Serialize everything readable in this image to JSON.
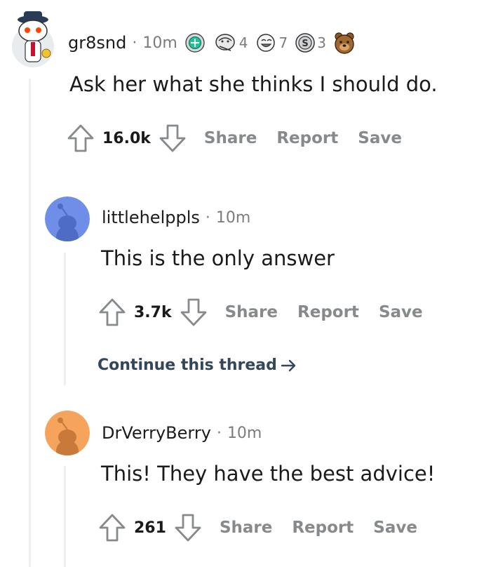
{
  "comments": [
    {
      "username": "gr8snd",
      "separator": "·",
      "time": "10m",
      "awards": [
        {
          "icon": "helpful-award-icon",
          "count": ""
        },
        {
          "icon": "wholesome-seal-award-icon",
          "count": "4"
        },
        {
          "icon": "laughing-face-award-icon",
          "count": "7"
        },
        {
          "icon": "silver-award-icon",
          "count": "3"
        },
        {
          "icon": "bear-award-icon",
          "count": ""
        }
      ],
      "body": "Ask her what she thinks I should do.",
      "score": "16.0k",
      "share_label": "Share",
      "report_label": "Report",
      "save_label": "Save"
    },
    {
      "username": "littlehelppls",
      "separator": "·",
      "time": "10m",
      "avatar_color": "#6f8ee8",
      "body": "This is the only answer",
      "score": "3.7k",
      "share_label": "Share",
      "report_label": "Report",
      "save_label": "Save",
      "continue_label": "Continue this thread"
    },
    {
      "username": "DrVerryBerry",
      "separator": "·",
      "time": "10m",
      "avatar_color": "#f6a35c",
      "body": "This! They have the best advice!",
      "score": "261",
      "share_label": "Share",
      "report_label": "Report",
      "save_label": "Save"
    }
  ],
  "colors": {
    "text": "#1a1a1b",
    "muted": "#878a8c",
    "thread_line": "#edeff1",
    "continue_link": "#33475b"
  }
}
